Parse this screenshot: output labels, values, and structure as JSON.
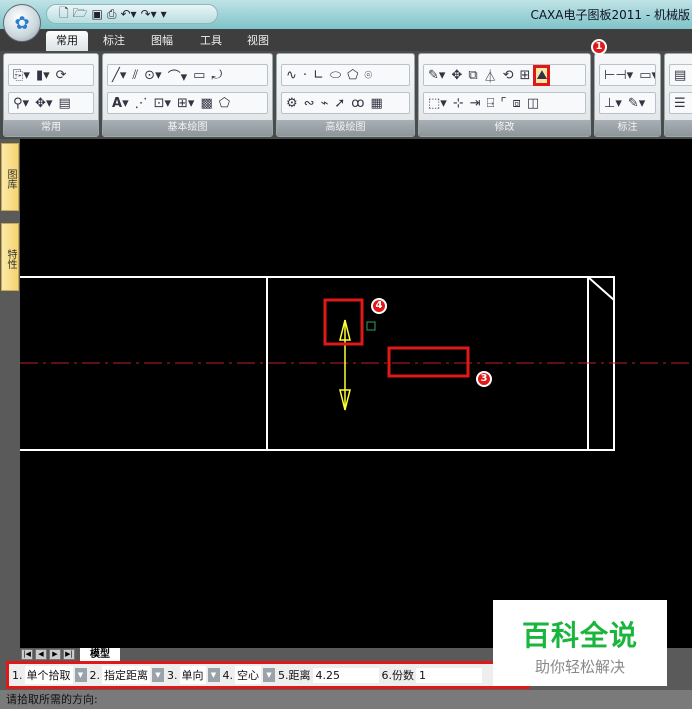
{
  "window": {
    "title": "CAXA电子图板2011 - 机械版"
  },
  "qat": {
    "icons": [
      "new-icon",
      "open-icon",
      "save-icon",
      "print-icon",
      "undo-icon",
      "redo-icon",
      "customize-icon"
    ]
  },
  "tabs": [
    {
      "label": "常用",
      "active": true
    },
    {
      "label": "标注"
    },
    {
      "label": "图幅"
    },
    {
      "label": "工具"
    },
    {
      "label": "视图"
    }
  ],
  "ribbon": {
    "groups": [
      {
        "label": "常用"
      },
      {
        "label": "基本绘图"
      },
      {
        "label": "高级绘图"
      },
      {
        "label": "修改"
      },
      {
        "label": "标注"
      }
    ]
  },
  "annotations": {
    "b1": "1",
    "b3": "3",
    "b4": "4"
  },
  "sidebar": {
    "tabs": [
      "图库",
      "特性"
    ]
  },
  "sheet": {
    "tab": "模型"
  },
  "options": {
    "o1_num": "1.",
    "o1_val": "单个拾取",
    "o2_num": "2.",
    "o2_val": "指定距离",
    "o3_num": "3.",
    "o3_val": "单向",
    "o4_num": "4.",
    "o4_val": "空心",
    "o5_label": "5.距离",
    "o5_val": "4.25",
    "o6_label": "6.份数",
    "o6_val": "1"
  },
  "status": {
    "prompt": "请拾取所需的方向:"
  },
  "watermark": {
    "title": "百科全说",
    "subtitle": "助你轻松解决"
  },
  "colors": {
    "highlight": "#e01818",
    "arrow": "#ffff33",
    "centerline": "#c0202a"
  }
}
